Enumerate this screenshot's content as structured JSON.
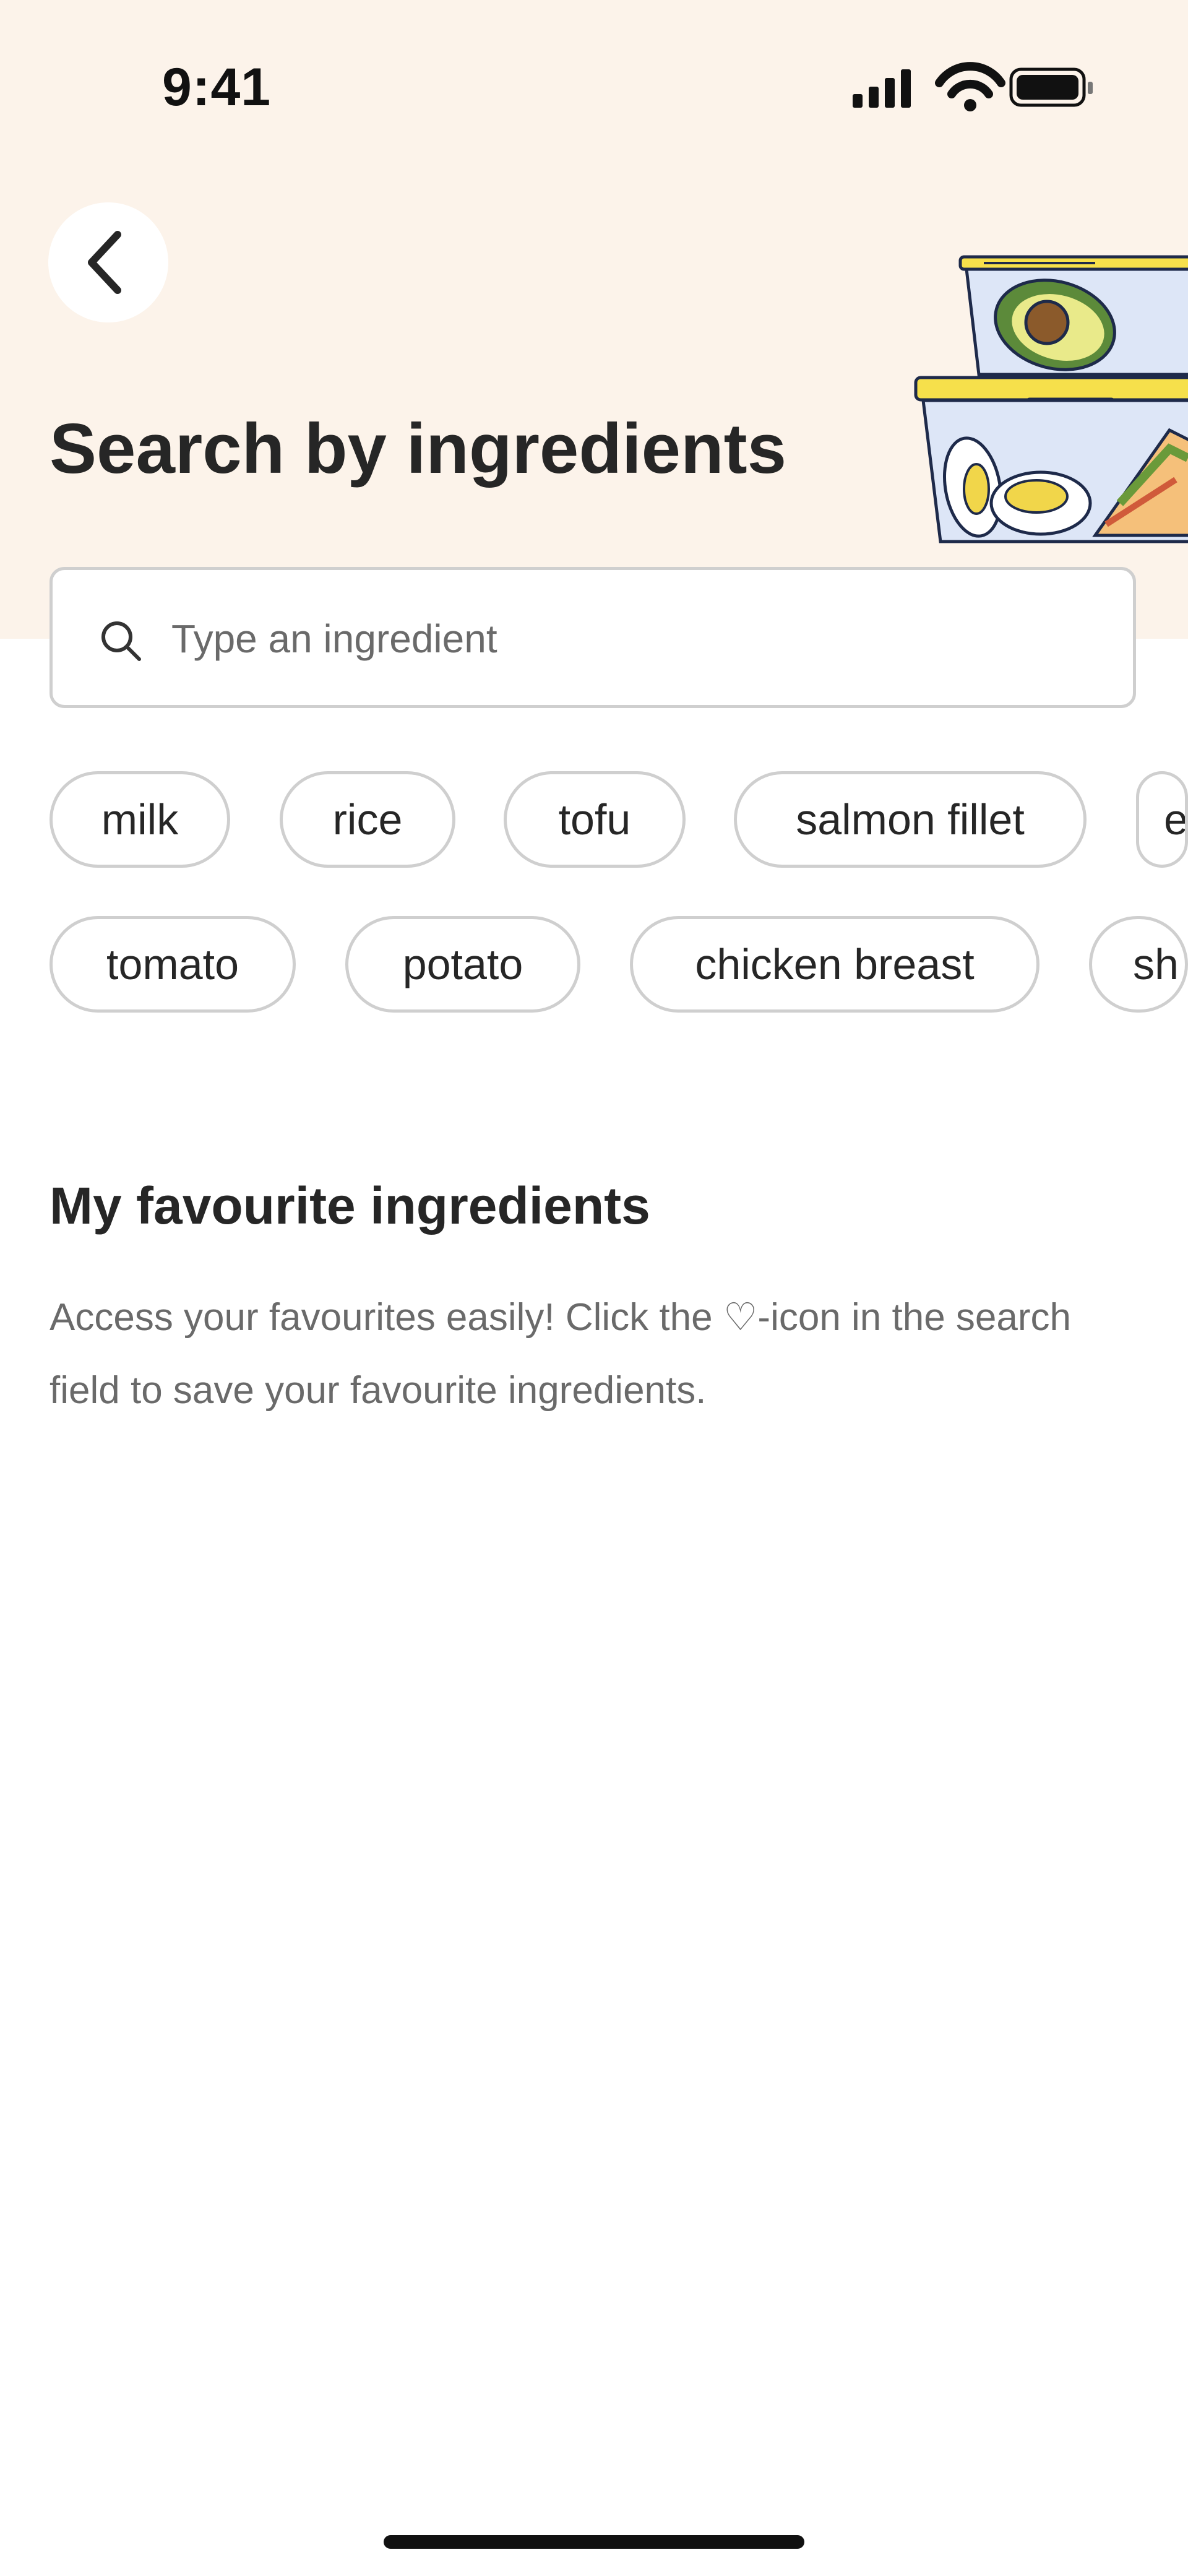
{
  "status_bar": {
    "time": "9:41",
    "icons": [
      "cellular-signal-icon",
      "wifi-icon",
      "battery-icon"
    ]
  },
  "header": {
    "back_icon": "chevron-left-icon",
    "title": "Search by ingredients",
    "illustration": "food-containers-illustration"
  },
  "search": {
    "icon": "search-icon",
    "placeholder": "Type an ingredient",
    "value": ""
  },
  "suggestions": {
    "row1": [
      {
        "label": "milk"
      },
      {
        "label": "rice"
      },
      {
        "label": "tofu"
      },
      {
        "label": "salmon fillet"
      },
      {
        "label": "e"
      }
    ],
    "row2": [
      {
        "label": "tomato"
      },
      {
        "label": "potato"
      },
      {
        "label": "chicken breast"
      },
      {
        "label": "sh"
      }
    ]
  },
  "favourites": {
    "title": "My favourite ingredients",
    "description": "Access your favourites easily! Click the ♡-icon in the search field to save your favourite ingredients."
  },
  "colors": {
    "header_background": "#fcf3ea",
    "chip_border": "#cfcfcf",
    "illustration_yellow": "#f6e04b",
    "illustration_blue": "#dde6f7"
  }
}
